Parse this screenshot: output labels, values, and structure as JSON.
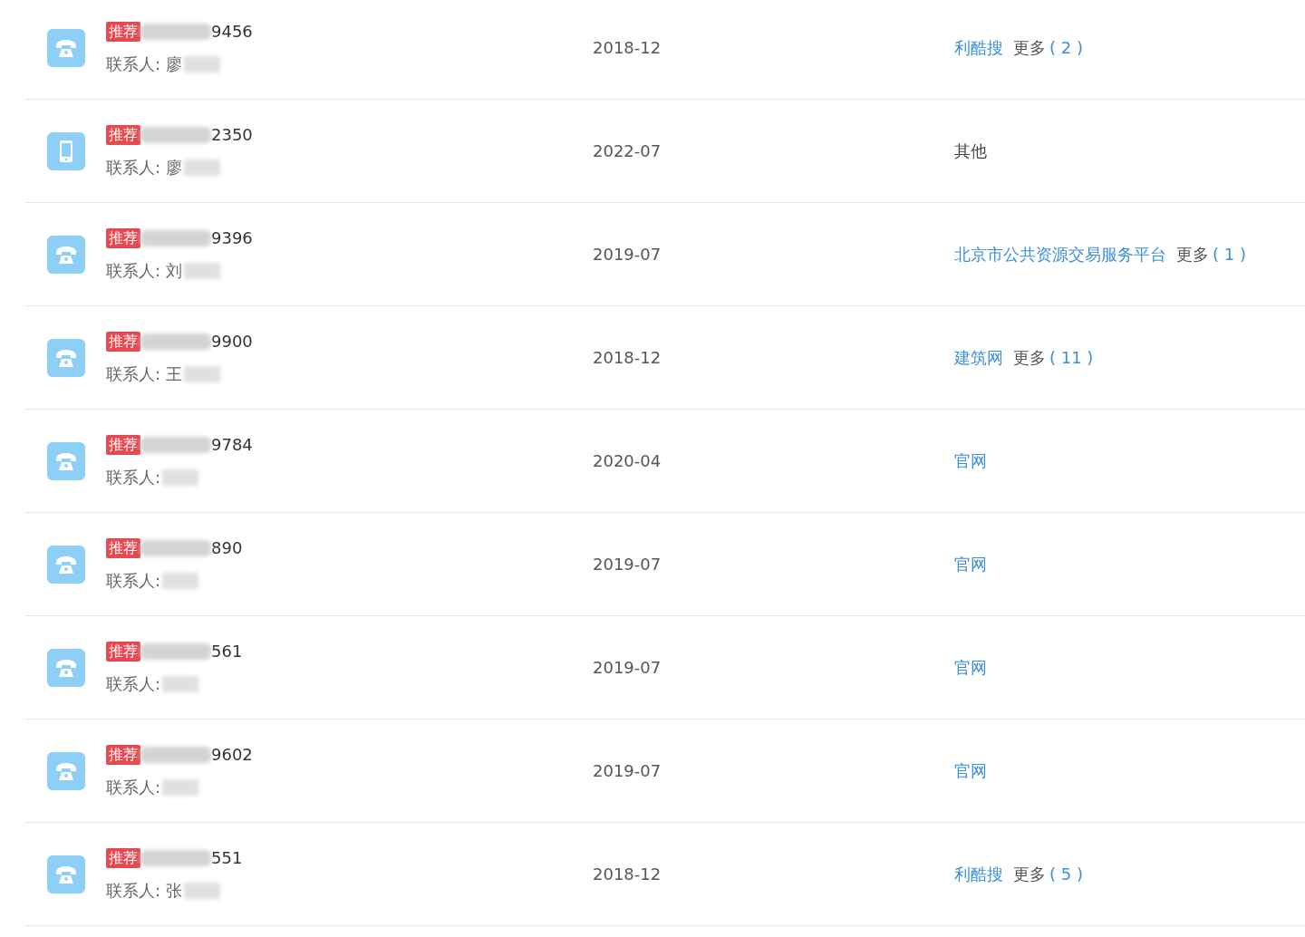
{
  "rows": [
    {
      "kind": "landline",
      "badge": "推荐",
      "number": "9456",
      "contact": "联系人: 廖",
      "date": "2018-12",
      "source": {
        "name": "利酷搜",
        "linked": true,
        "more": "更多",
        "count": "( 2 )"
      }
    },
    {
      "kind": "mobile",
      "badge": "推荐",
      "number": "2350",
      "contact": "联系人: 廖",
      "date": "2022-07",
      "source": {
        "name": "其他",
        "linked": false
      }
    },
    {
      "kind": "landline",
      "badge": "推荐",
      "number": "9396",
      "contact": "联系人: 刘",
      "date": "2019-07",
      "source": {
        "name": "北京市公共资源交易服务平台",
        "linked": true,
        "more": "更多",
        "count": "( 1 )"
      }
    },
    {
      "kind": "landline",
      "badge": "推荐",
      "number": "9900",
      "contact": "联系人: 王",
      "date": "2018-12",
      "source": {
        "name": "建筑网",
        "linked": true,
        "more": "更多",
        "count": "( 11 )"
      }
    },
    {
      "kind": "landline",
      "badge": "推荐",
      "number": "9784",
      "contact": "联系人:",
      "date": "2020-04",
      "source": {
        "name": "官网",
        "linked": true
      }
    },
    {
      "kind": "landline",
      "badge": "推荐",
      "number": "890",
      "contact": "联系人:",
      "date": "2019-07",
      "source": {
        "name": "官网",
        "linked": true
      }
    },
    {
      "kind": "landline",
      "badge": "推荐",
      "number": "561",
      "contact": "联系人:",
      "date": "2019-07",
      "source": {
        "name": "官网",
        "linked": true
      }
    },
    {
      "kind": "landline",
      "badge": "推荐",
      "number": "9602",
      "contact": "联系人:",
      "date": "2019-07",
      "source": {
        "name": "官网",
        "linked": true
      }
    },
    {
      "kind": "landline",
      "badge": "推荐",
      "number": "551",
      "contact": "联系人: 张",
      "date": "2018-12",
      "source": {
        "name": "利酷搜",
        "linked": true,
        "more": "更多",
        "count": "( 5 )"
      }
    }
  ]
}
